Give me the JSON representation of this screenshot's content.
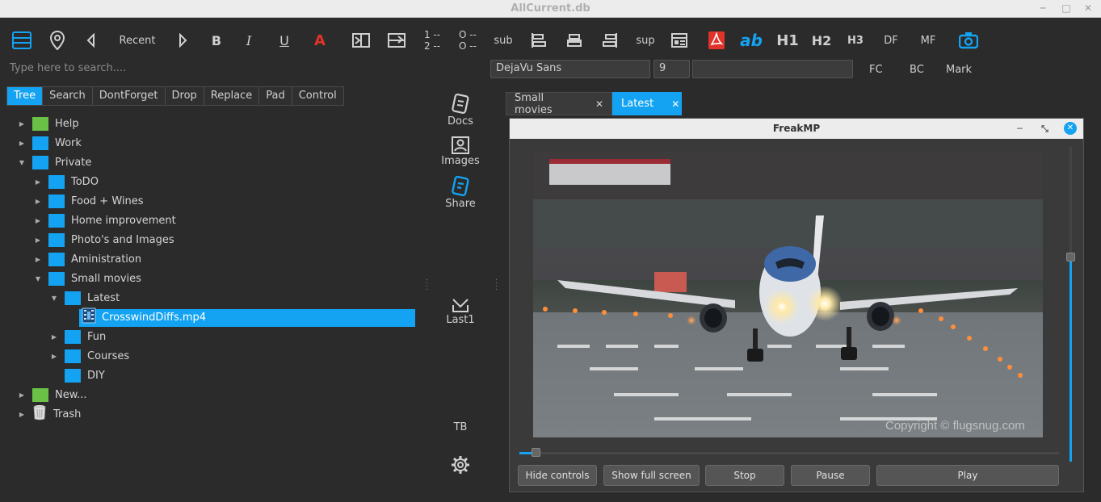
{
  "window": {
    "title": "AllCurrent.db"
  },
  "toolbar": {
    "recent": "Recent",
    "bold": "B",
    "italic": "I",
    "underline": "U",
    "fontcolor": "A",
    "list_numbered": [
      "1 --",
      "2 --"
    ],
    "list_bullets": [
      "O --",
      "O --"
    ],
    "sub": "sub",
    "sup": "sup",
    "spell": "ab",
    "h1": "H1",
    "h2": "H2",
    "h3": "H3",
    "df": "DF",
    "mf": "MF"
  },
  "search": {
    "placeholder": "Type here to search...."
  },
  "format": {
    "font": "DejaVu Sans",
    "size": "9",
    "style": "",
    "fc": "FC",
    "bc": "BC",
    "mark": "Mark"
  },
  "tabs": [
    "Tree",
    "Search",
    "DontForget",
    "Drop",
    "Replace",
    "Pad",
    "Control"
  ],
  "tree": [
    {
      "label": "Help",
      "level": 0,
      "arrow": "right",
      "icon": "folder-green"
    },
    {
      "label": "Work",
      "level": 0,
      "arrow": "right",
      "icon": "folder-blue"
    },
    {
      "label": "Private",
      "level": 0,
      "arrow": "down",
      "icon": "folder-blue"
    },
    {
      "label": "ToDO",
      "level": 1,
      "arrow": "right",
      "icon": "folder-blue"
    },
    {
      "label": "Food + Wines",
      "level": 1,
      "arrow": "right",
      "icon": "folder-blue"
    },
    {
      "label": "Home improvement",
      "level": 1,
      "arrow": "right",
      "icon": "folder-blue"
    },
    {
      "label": "Photo's and Images",
      "level": 1,
      "arrow": "right",
      "icon": "folder-blue"
    },
    {
      "label": "Aministration",
      "level": 1,
      "arrow": "right",
      "icon": "folder-blue"
    },
    {
      "label": "Small movies",
      "level": 1,
      "arrow": "down",
      "icon": "folder-blue"
    },
    {
      "label": "Latest",
      "level": 2,
      "arrow": "down",
      "icon": "folder-blue"
    },
    {
      "label": "CrosswindDiffs.mp4",
      "level": 3,
      "arrow": "none",
      "icon": "video-file"
    },
    {
      "label": "Fun",
      "level": 2,
      "arrow": "right",
      "icon": "folder-blue"
    },
    {
      "label": "Courses",
      "level": 2,
      "arrow": "right",
      "icon": "folder-blue"
    },
    {
      "label": "DIY",
      "level": 2,
      "arrow": "none",
      "icon": "folder-blue"
    },
    {
      "label": "New...",
      "level": 0,
      "arrow": "right",
      "icon": "folder-green"
    },
    {
      "label": "Trash",
      "level": 0,
      "arrow": "right",
      "icon": "trash-can"
    }
  ],
  "sidepanel": {
    "docs": "Docs",
    "images": "Images",
    "share": "Share",
    "last1": "Last1",
    "tb": "TB"
  },
  "doc_tabs": [
    {
      "label": "Small movies",
      "active": false
    },
    {
      "label": "Latest",
      "active": true
    }
  ],
  "player": {
    "title": "FreakMP",
    "watermark": "Copyright © flugsnug.com",
    "buttons": {
      "hide": "Hide controls",
      "fullscreen": "Show full screen",
      "stop": "Stop",
      "pause": "Pause",
      "play": "Play"
    },
    "volume": 0.65,
    "position": 0.03
  },
  "colors": {
    "accent": "#13a3f2",
    "folder_blue": "#13a3f2",
    "folder_green": "#6ac146",
    "pdf_red": "#e0342a"
  }
}
